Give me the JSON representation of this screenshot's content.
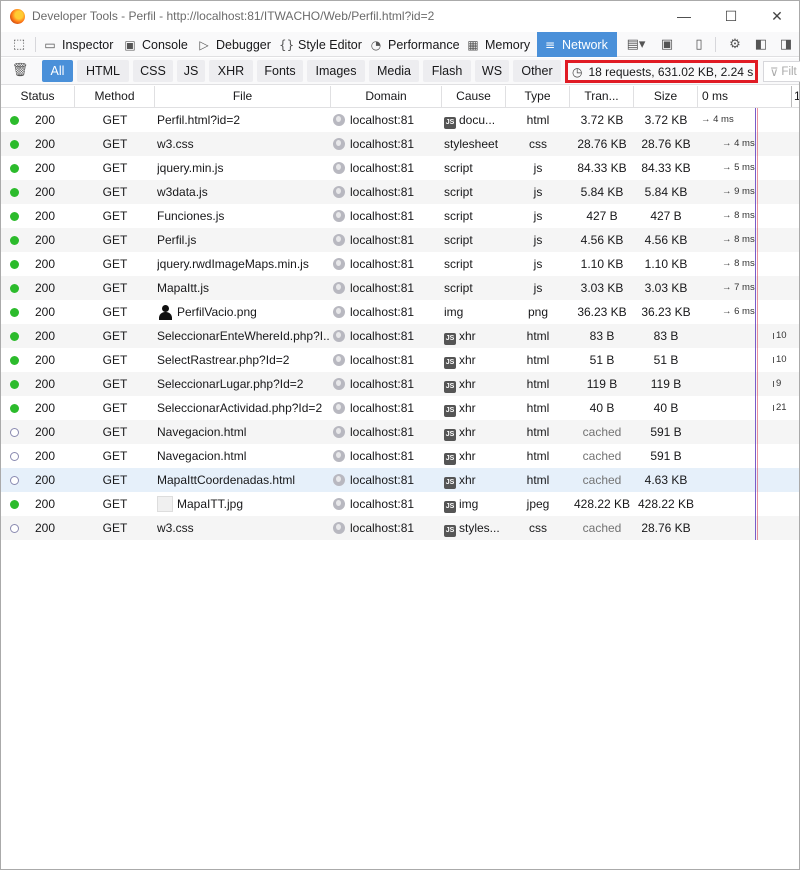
{
  "window": {
    "title": "Developer Tools - Perfil - http://localhost:81/ITWACHO/Web/Perfil.html?id=2",
    "minimize": "—",
    "maximize": "☐",
    "close": "✕"
  },
  "toolbar": {
    "tools": [
      {
        "label": "Inspector"
      },
      {
        "label": "Console"
      },
      {
        "label": "Debugger"
      },
      {
        "label": "Style Editor"
      },
      {
        "label": "Performance"
      },
      {
        "label": "Memory"
      },
      {
        "label": "Network"
      }
    ],
    "accent": "#4a90d9"
  },
  "filters": {
    "buttons": [
      "All",
      "HTML",
      "CSS",
      "JS",
      "XHR",
      "Fonts",
      "Images",
      "Media",
      "Flash",
      "WS",
      "Other"
    ],
    "active": "All",
    "summary": "18 requests, 631.02 KB, 2.24 s",
    "filter_placeholder": "Filt"
  },
  "columns": {
    "status": "Status",
    "method": "Method",
    "file": "File",
    "domain": "Domain",
    "cause": "Cause",
    "type": "Type",
    "transferred": "Tran...",
    "size": "Size",
    "waterfall": "0 ms",
    "waterfall_next": "1"
  },
  "requests": [
    {
      "status": "200",
      "method": "GET",
      "file": "Perfil.html?id=2",
      "domain": "localhost:81",
      "cause": "docu...",
      "cause_js": true,
      "type": "html",
      "transferred": "3.72 KB",
      "size": "3.72 KB",
      "timing": "→ 4 ms",
      "state": "ok"
    },
    {
      "status": "200",
      "method": "GET",
      "file": "w3.css",
      "domain": "localhost:81",
      "cause": "stylesheet",
      "cause_js": false,
      "type": "css",
      "transferred": "28.76 KB",
      "size": "28.76 KB",
      "timing": "→ 4 ms",
      "state": "ok"
    },
    {
      "status": "200",
      "method": "GET",
      "file": "jquery.min.js",
      "domain": "localhost:81",
      "cause": "script",
      "cause_js": false,
      "type": "js",
      "transferred": "84.33 KB",
      "size": "84.33 KB",
      "timing": "→ 5 ms",
      "state": "ok"
    },
    {
      "status": "200",
      "method": "GET",
      "file": "w3data.js",
      "domain": "localhost:81",
      "cause": "script",
      "cause_js": false,
      "type": "js",
      "transferred": "5.84 KB",
      "size": "5.84 KB",
      "timing": "→ 9 ms",
      "state": "ok"
    },
    {
      "status": "200",
      "method": "GET",
      "file": "Funciones.js",
      "domain": "localhost:81",
      "cause": "script",
      "cause_js": false,
      "type": "js",
      "transferred": "427 B",
      "size": "427 B",
      "timing": "→ 8 ms",
      "state": "ok"
    },
    {
      "status": "200",
      "method": "GET",
      "file": "Perfil.js",
      "domain": "localhost:81",
      "cause": "script",
      "cause_js": false,
      "type": "js",
      "transferred": "4.56 KB",
      "size": "4.56 KB",
      "timing": "→ 8 ms",
      "state": "ok"
    },
    {
      "status": "200",
      "method": "GET",
      "file": "jquery.rwdImageMaps.min.js",
      "domain": "localhost:81",
      "cause": "script",
      "cause_js": false,
      "type": "js",
      "transferred": "1.10 KB",
      "size": "1.10 KB",
      "timing": "→ 8 ms",
      "state": "ok"
    },
    {
      "status": "200",
      "method": "GET",
      "file": "MapaItt.js",
      "domain": "localhost:81",
      "cause": "script",
      "cause_js": false,
      "type": "js",
      "transferred": "3.03 KB",
      "size": "3.03 KB",
      "timing": "→ 7 ms",
      "state": "ok"
    },
    {
      "status": "200",
      "method": "GET",
      "file": "PerfilVacio.png",
      "thumb": "person",
      "domain": "localhost:81",
      "cause": "img",
      "cause_js": false,
      "type": "png",
      "transferred": "36.23 KB",
      "size": "36.23 KB",
      "timing": "→ 6 ms",
      "state": "ok"
    },
    {
      "status": "200",
      "method": "GET",
      "file": "SeleccionarEnteWhereId.php?I...",
      "domain": "localhost:81",
      "cause": "xhr",
      "cause_js": true,
      "type": "html",
      "transferred": "83 B",
      "size": "83 B",
      "timing": "10",
      "state": "ok"
    },
    {
      "status": "200",
      "method": "GET",
      "file": "SelectRastrear.php?Id=2",
      "domain": "localhost:81",
      "cause": "xhr",
      "cause_js": true,
      "type": "html",
      "transferred": "51 B",
      "size": "51 B",
      "timing": "10",
      "state": "ok"
    },
    {
      "status": "200",
      "method": "GET",
      "file": "SeleccionarLugar.php?Id=2",
      "domain": "localhost:81",
      "cause": "xhr",
      "cause_js": true,
      "type": "html",
      "transferred": "119 B",
      "size": "119 B",
      "timing": "9",
      "state": "ok"
    },
    {
      "status": "200",
      "method": "GET",
      "file": "SeleccionarActividad.php?Id=2",
      "domain": "localhost:81",
      "cause": "xhr",
      "cause_js": true,
      "type": "html",
      "transferred": "40 B",
      "size": "40 B",
      "timing": "21",
      "state": "ok"
    },
    {
      "status": "200",
      "method": "GET",
      "file": "Navegacion.html",
      "domain": "localhost:81",
      "cause": "xhr",
      "cause_js": true,
      "type": "html",
      "transferred": "cached",
      "size": "591 B",
      "timing": "",
      "state": "cached"
    },
    {
      "status": "200",
      "method": "GET",
      "file": "Navegacion.html",
      "domain": "localhost:81",
      "cause": "xhr",
      "cause_js": true,
      "type": "html",
      "transferred": "cached",
      "size": "591 B",
      "timing": "",
      "state": "cached"
    },
    {
      "status": "200",
      "method": "GET",
      "file": "MapaIttCoordenadas.html",
      "domain": "localhost:81",
      "cause": "xhr",
      "cause_js": true,
      "type": "html",
      "transferred": "cached",
      "size": "4.63 KB",
      "timing": "",
      "state": "cached",
      "selected": true
    },
    {
      "status": "200",
      "method": "GET",
      "file": "MapaITT.jpg",
      "thumb": "map",
      "domain": "localhost:81",
      "cause": "img",
      "cause_js": true,
      "type": "jpeg",
      "transferred": "428.22 KB",
      "size": "428.22 KB",
      "timing": "",
      "state": "ok"
    },
    {
      "status": "200",
      "method": "GET",
      "file": "w3.css",
      "domain": "localhost:81",
      "cause": "styles...",
      "cause_js": true,
      "type": "css",
      "transferred": "cached",
      "size": "28.76 KB",
      "timing": "",
      "state": "cached"
    }
  ],
  "colors": {
    "ok": "#2cbb2c",
    "highlight_border": "#e01b24",
    "dom_content_loaded": "#7a5cc8",
    "load": "#d7263d"
  }
}
